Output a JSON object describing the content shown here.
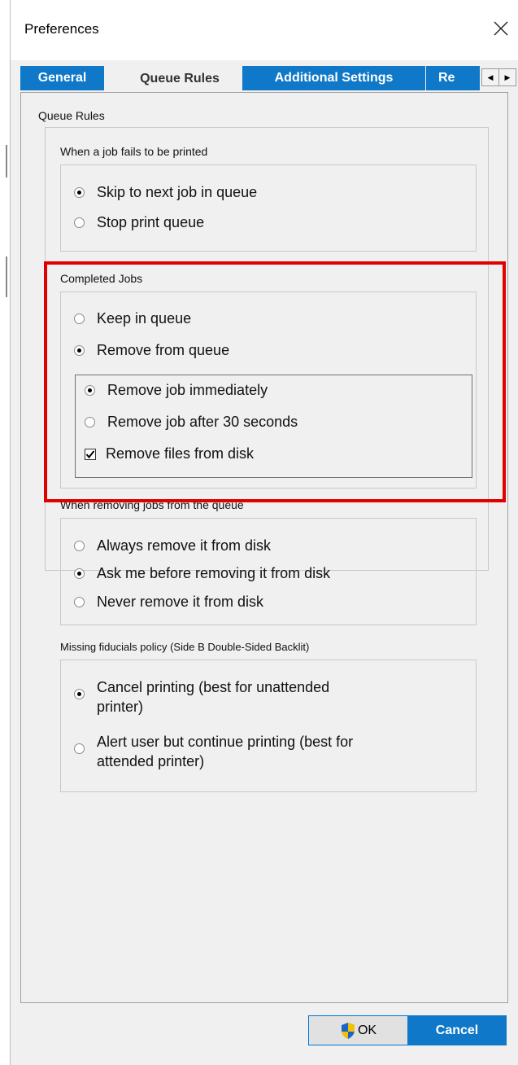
{
  "window": {
    "title": "Preferences"
  },
  "tabs": [
    {
      "label": "General",
      "active": false
    },
    {
      "label": "Queue Rules",
      "active": true
    },
    {
      "label": "Additional Settings",
      "active": false
    },
    {
      "label": "Re",
      "active": false
    }
  ],
  "queue_rules": {
    "label": "Queue Rules",
    "failed_job": {
      "label": "When a job fails to be printed",
      "options": [
        {
          "label": "Skip to next job in queue",
          "checked": true
        },
        {
          "label": "Stop print queue",
          "checked": false
        }
      ]
    },
    "completed_jobs": {
      "label": "Completed Jobs",
      "options": [
        {
          "label": "Keep in queue",
          "checked": false
        },
        {
          "label": "Remove from queue",
          "checked": true
        }
      ],
      "removal": {
        "options": [
          {
            "label": "Remove job immediately",
            "checked": true
          },
          {
            "label": "Remove job after 30 seconds",
            "checked": false
          }
        ],
        "remove_files_label": "Remove files from disk",
        "remove_files_checked": true
      }
    },
    "removing_jobs": {
      "label": "When removing jobs from the queue",
      "options": [
        {
          "label": "Always remove it from disk",
          "checked": false
        },
        {
          "label": "Ask me before removing it from disk",
          "checked": true
        },
        {
          "label": "Never remove it from disk",
          "checked": false
        }
      ]
    },
    "missing_fiducials": {
      "label": "Missing fiducials policy (Side B Double-Sided Backlit)",
      "options": [
        {
          "line1": "Cancel printing (best for unattended",
          "line2": "printer)",
          "checked": true
        },
        {
          "line1": "Alert user but continue printing (best for",
          "line2": "attended printer)",
          "checked": false
        }
      ]
    }
  },
  "buttons": {
    "ok_label": "OK",
    "cancel_label": "Cancel"
  },
  "colors": {
    "accent": "#0f78c8",
    "highlight": "#e00000"
  },
  "icons": {
    "close": "close-icon",
    "shield": "shield-icon",
    "scroll_left": "scroll-left-icon",
    "scroll_right": "scroll-right-icon"
  }
}
